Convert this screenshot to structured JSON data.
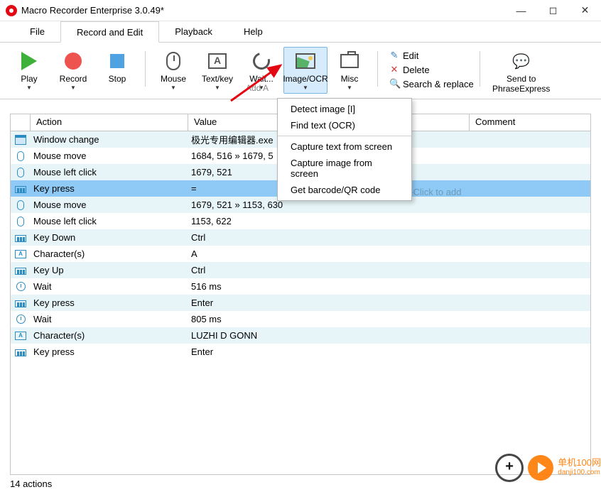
{
  "window": {
    "title": "Macro Recorder Enterprise 3.0.49*"
  },
  "menu": {
    "file": "File",
    "record_edit": "Record and Edit",
    "playback": "Playback",
    "help": "Help"
  },
  "toolbar": {
    "play": "Play",
    "record": "Record",
    "stop": "Stop",
    "mouse": "Mouse",
    "textkey": "Text/key",
    "wait": "Wait...",
    "imageocr": "Image/OCR",
    "misc": "Misc",
    "group2_caption": "Add A",
    "edit": "Edit",
    "delete": "Delete",
    "search_replace": "Search & replace",
    "sendto": "Send to",
    "sendto2": "PhraseExpress"
  },
  "dropdown": {
    "items": [
      "Detect image [I]",
      "Find text (OCR)",
      "Capture text from screen",
      "Capture image from screen",
      "Get barcode/QR code"
    ]
  },
  "table": {
    "headers": {
      "action": "Action",
      "value": "Value",
      "comment": "Comment"
    },
    "hint": "Double-Click to add",
    "rows": [
      {
        "icon": "win",
        "action": "Window change",
        "value": "极光专用编辑器.exe"
      },
      {
        "icon": "mouse",
        "action": "Mouse move",
        "value": "1684, 516 » 1679, 5"
      },
      {
        "icon": "mouse",
        "action": "Mouse left click",
        "value": "1679, 521"
      },
      {
        "icon": "key",
        "action": "Key press",
        "value": "=",
        "selected": true
      },
      {
        "icon": "mouse",
        "action": "Mouse move",
        "value": "1679, 521 » 1153, 630"
      },
      {
        "icon": "mouse",
        "action": "Mouse left click",
        "value": "1153, 622"
      },
      {
        "icon": "key",
        "action": "Key Down",
        "value": "Ctrl"
      },
      {
        "icon": "char",
        "action": "Character(s)",
        "value": "A"
      },
      {
        "icon": "key",
        "action": "Key Up",
        "value": "Ctrl"
      },
      {
        "icon": "wait",
        "action": "Wait",
        "value": "516 ms"
      },
      {
        "icon": "key",
        "action": "Key press",
        "value": "Enter"
      },
      {
        "icon": "wait",
        "action": "Wait",
        "value": "805 ms"
      },
      {
        "icon": "char",
        "action": "Character(s)",
        "value": "LUZHI D GONN"
      },
      {
        "icon": "key",
        "action": "Key press",
        "value": "Enter"
      }
    ]
  },
  "status": {
    "text": "14 actions"
  },
  "watermark": {
    "line1": "单机100网",
    "line2": "danji100.com"
  }
}
